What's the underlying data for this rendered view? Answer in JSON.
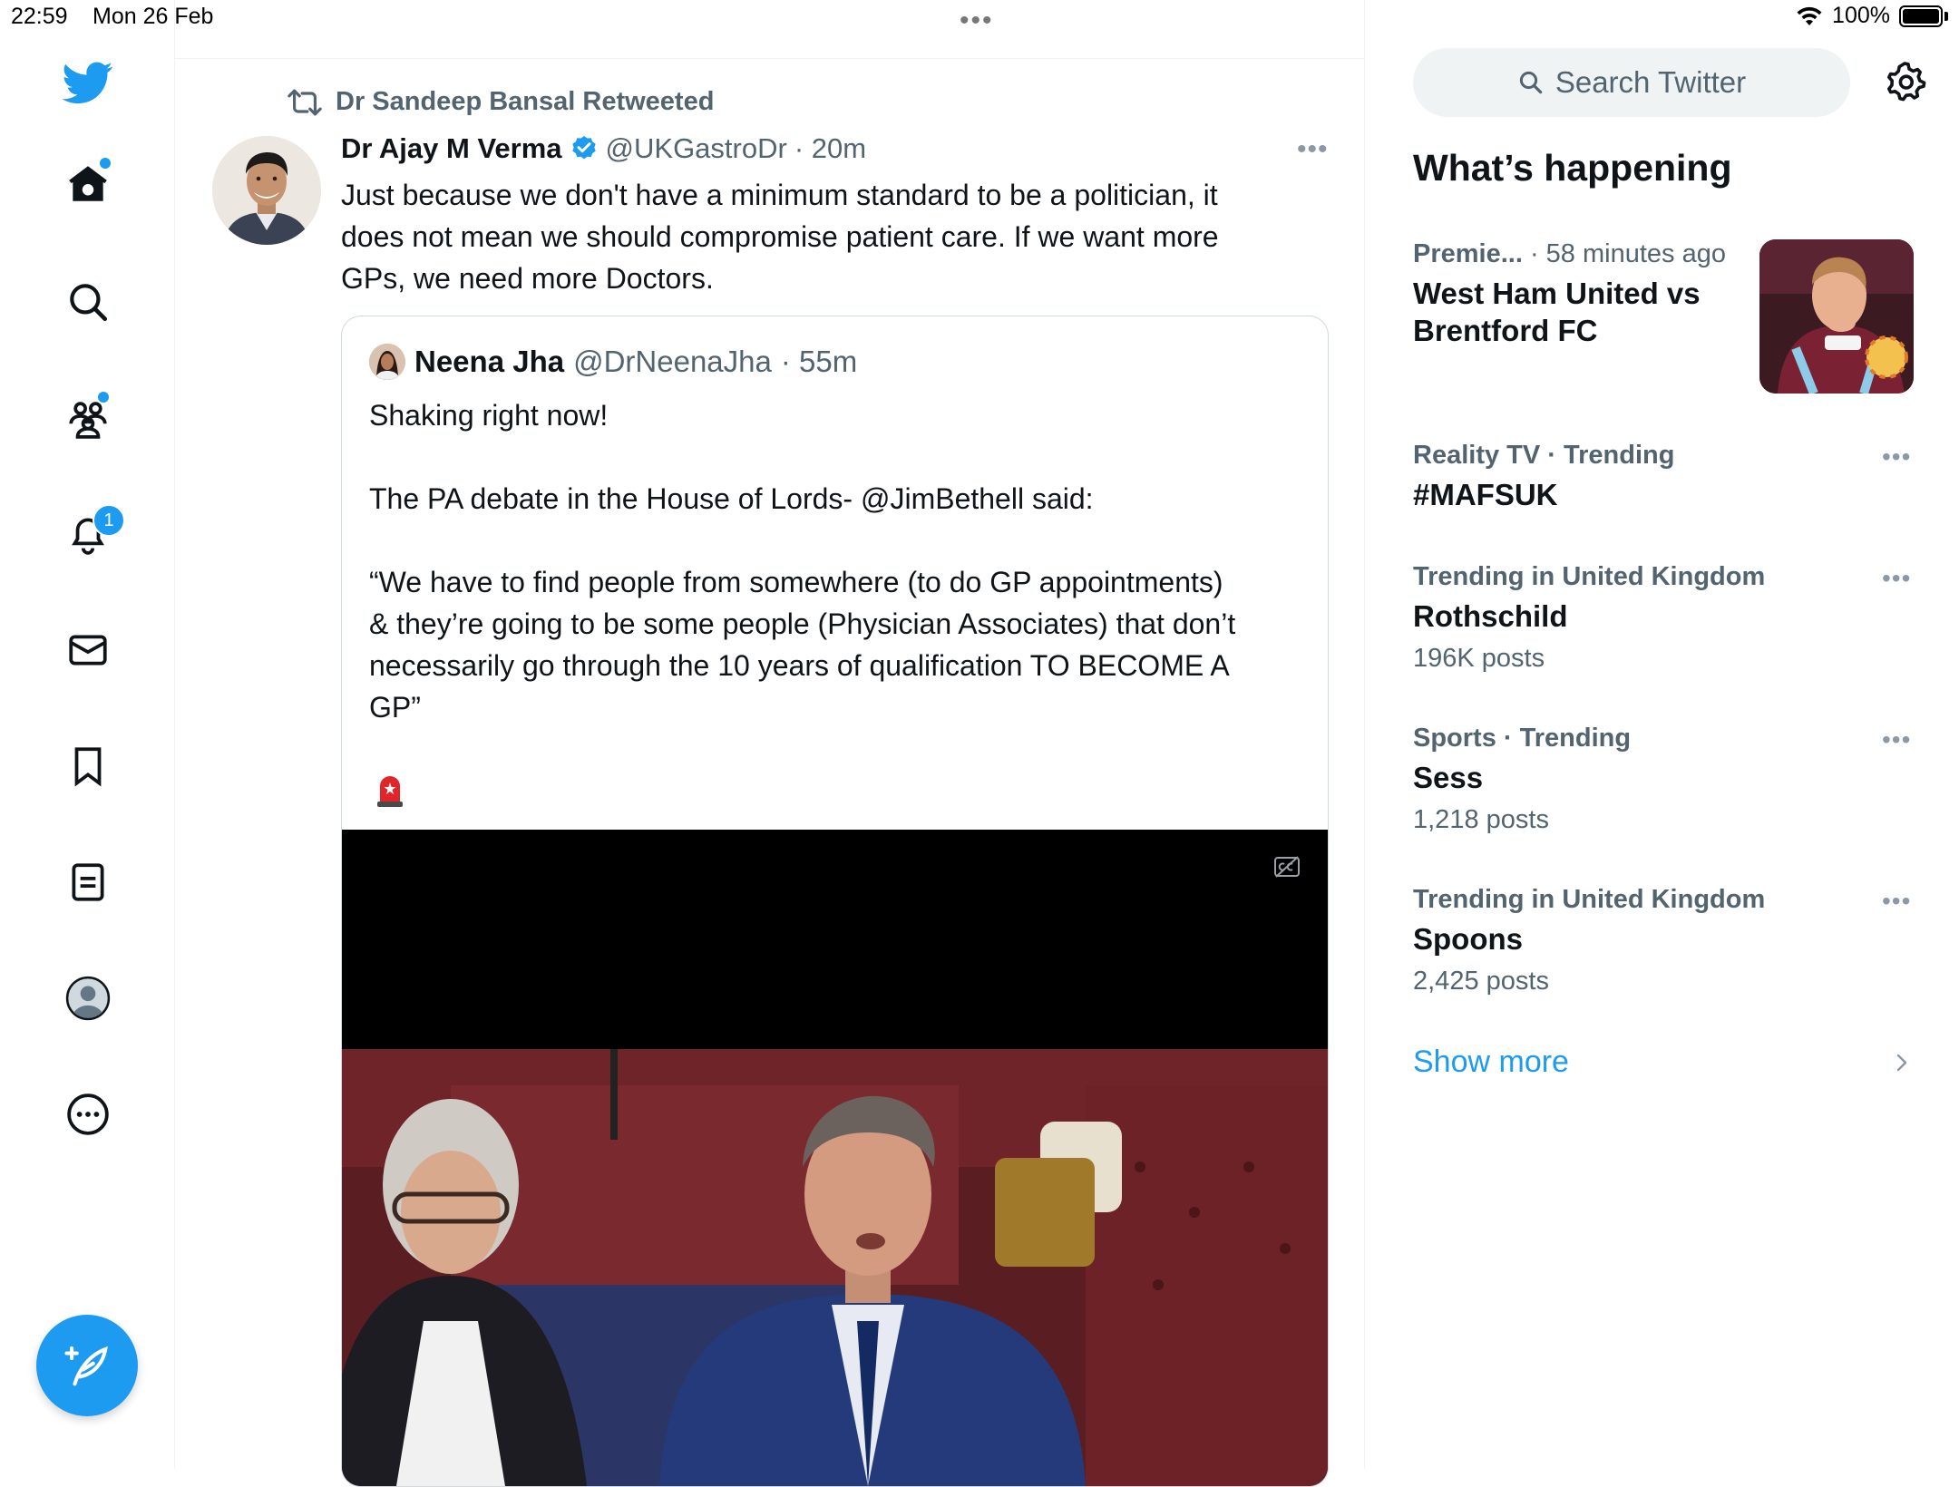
{
  "status_bar": {
    "time": "22:59",
    "date": "Mon 26 Feb",
    "multitask_dots": "•••",
    "battery": "100%"
  },
  "nav": {
    "items": [
      "logo",
      "home",
      "explore",
      "communities",
      "notifications",
      "messages",
      "bookmarks",
      "lists",
      "profile",
      "more"
    ],
    "notification_count": "1"
  },
  "tweet": {
    "retweeted_by": "Dr Sandeep Bansal Retweeted",
    "author_name": "Dr Ajay M Verma",
    "author_handle": "@UKGastroDr",
    "time": "· 20m",
    "more": "•••",
    "text": "Just because we don't have a minimum standard to be a politician, it\ndoes not mean we should compromise patient care. If we want more\nGPs, we need more Doctors.",
    "quote": {
      "author_name": "Neena Jha",
      "author_handle": "@DrNeenaJha",
      "time": "· 55m",
      "text": "Shaking right now!\n\nThe PA debate in the House of Lords- @JimBethell said:\n\n“We have to find people from somewhere (to do GP appointments)\n& they’re going to be some people (Physician Associates) that don’t\nnecessarily go through the 10 years of qualification TO BECOME A\nGP”"
    }
  },
  "sidebar": {
    "search_placeholder": "Search Twitter",
    "section_title": "What’s happening",
    "trends": [
      {
        "meta_bold": "Premie...",
        "meta_light": " · 58 minutes ago",
        "title": "West Ham United vs\nBrentford FC",
        "count": ""
      },
      {
        "meta_bold": "Reality TV · Trending",
        "meta_light": "",
        "title": "#MAFSUK",
        "count": ""
      },
      {
        "meta_bold": "Trending in United Kingdom",
        "meta_light": "",
        "title": "Rothschild",
        "count": "196K posts"
      },
      {
        "meta_bold": "Sports · Trending",
        "meta_light": "",
        "title": "Sess",
        "count": "1,218 posts"
      },
      {
        "meta_bold": "Trending in United Kingdom",
        "meta_light": "",
        "title": "Spoons",
        "count": "2,425 posts"
      }
    ],
    "trend_more": "•••",
    "show_more": "Show more"
  },
  "colors": {
    "accent": "#1d9bf0",
    "text_primary": "#0f1419",
    "text_secondary": "#536471",
    "border": "#eff3f4"
  }
}
